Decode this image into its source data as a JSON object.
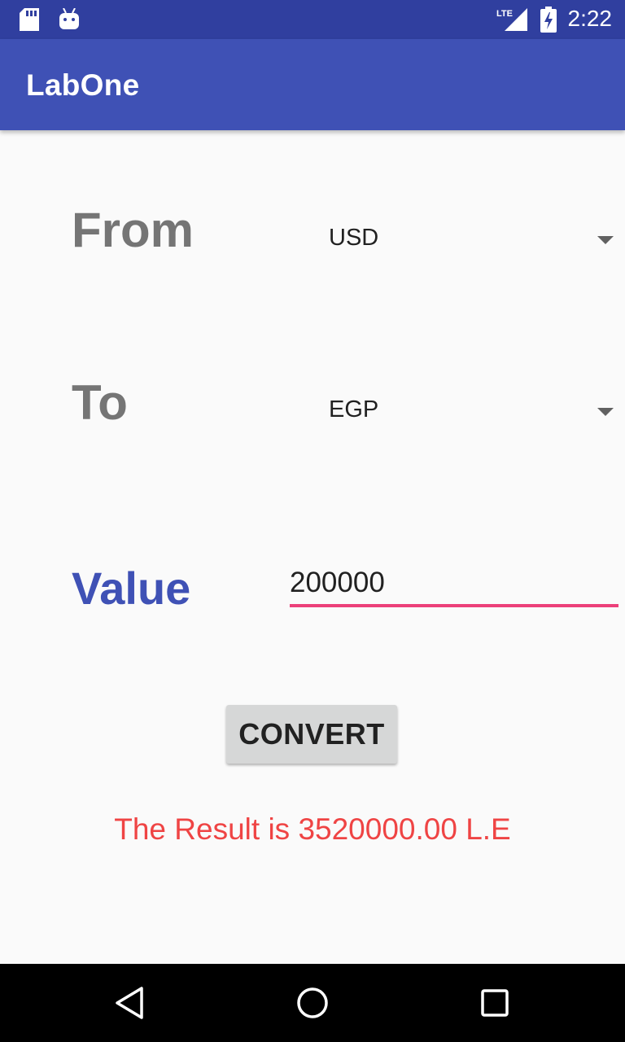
{
  "status_bar": {
    "time": "2:22",
    "network": "LTE",
    "icons": [
      "sd-card-icon",
      "android-icon",
      "lte-signal-icon",
      "battery-charging-icon"
    ]
  },
  "app_bar": {
    "title": "LabOne"
  },
  "form": {
    "from_label": "From",
    "from_value": "USD",
    "to_label": "To",
    "to_value": "EGP",
    "value_label": "Value",
    "value_input": "200000"
  },
  "convert_button": {
    "label": "CONVERT"
  },
  "result": {
    "text": "The Result is 3520000.00 L.E"
  },
  "colors": {
    "primary": "#3f51b5",
    "primary_dark": "#303f9f",
    "accent": "#ec407a",
    "result": "#ef4444"
  },
  "nav_bar": {
    "icons": [
      "back-icon",
      "home-icon",
      "recents-icon"
    ]
  }
}
